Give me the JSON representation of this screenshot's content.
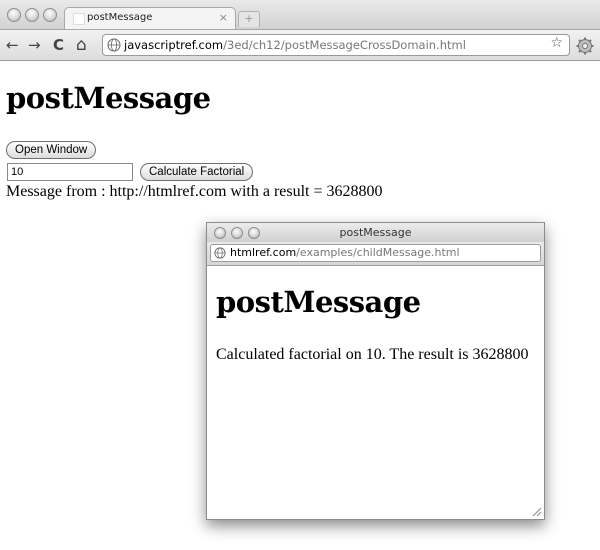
{
  "browser": {
    "tab_title": "postMessage",
    "tab_close": "×",
    "new_tab": "+",
    "url_host": "javascriptref.com",
    "url_path": "/3ed/ch12/postMessageCrossDomain.html",
    "back": "←",
    "forward": "→",
    "reload": "C",
    "home": "⌂",
    "star": "☆"
  },
  "page": {
    "heading": "postMessage",
    "open_window_label": "Open Window",
    "input_value": "10",
    "calculate_label": "Calculate Factorial",
    "message": "Message from : http://htmlref.com with a result = 3628800"
  },
  "popup": {
    "window_title": "postMessage",
    "url_host": "htmlref.com",
    "url_path": "/examples/childMessage.html",
    "heading": "postMessage",
    "text": "Calculated factorial on 10. The result is 3628800"
  }
}
